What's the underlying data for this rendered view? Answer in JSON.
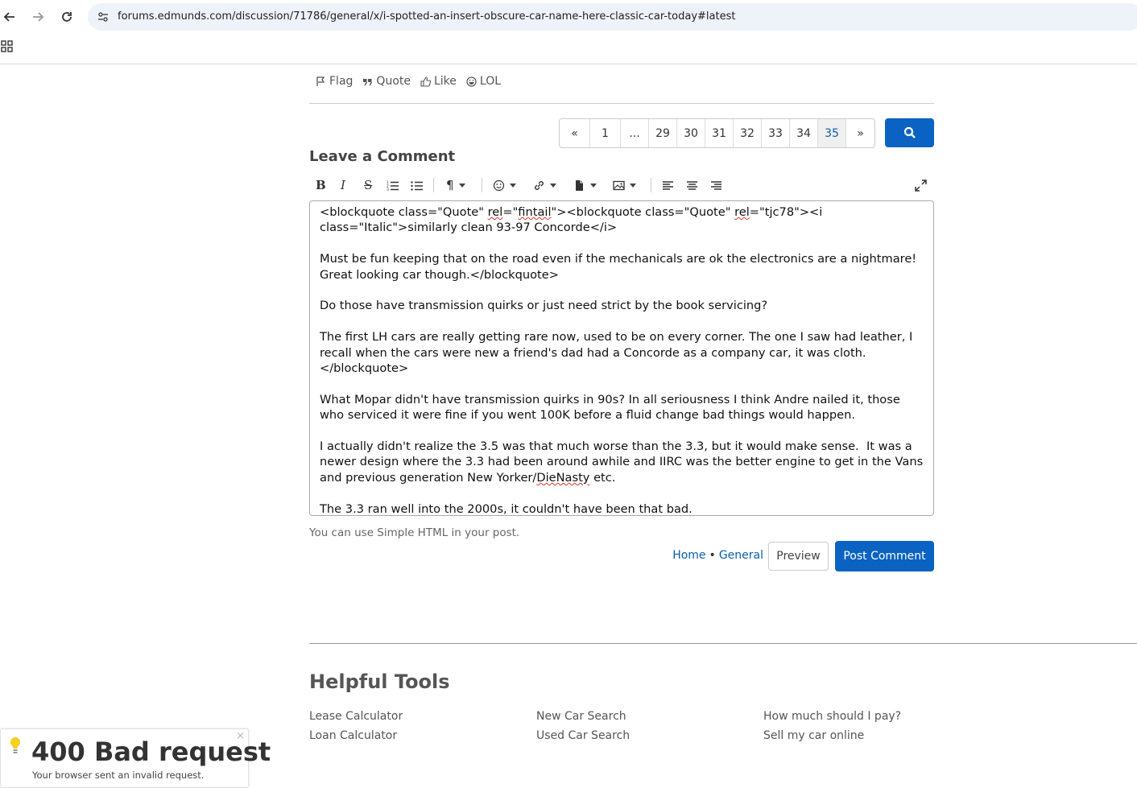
{
  "browser": {
    "url": "forums.edmunds.com/discussion/71786/general/x/i-spotted-an-insert-obscure-car-name-here-classic-car-today#latest",
    "icons": [
      "back-arrow-icon",
      "forward-arrow-icon",
      "reload-icon",
      "site-info-icon",
      "apps-grid-icon"
    ]
  },
  "post_actions": {
    "flag": "Flag",
    "quote": "Quote",
    "like": "Like",
    "lol": "LOL"
  },
  "pagination": {
    "prev": "«",
    "pages": [
      "1",
      "...",
      "29",
      "30",
      "31",
      "32",
      "33",
      "34",
      "35"
    ],
    "active": "35",
    "next": "»"
  },
  "comment": {
    "title": "Leave a Comment",
    "paragraphs": [
      "<blockquote class=\"Quote\" rel=\"fintail\"><blockquote class=\"Quote\" rel=\"tjc78\"><i class=\"Italic\">similarly clean 93-97 Concorde</i>",
      "Must be fun keeping that on the road even if the mechanicals are ok the electronics are a nightmare!  Great looking car though.</blockquote>",
      "Do those have transmission quirks or just need strict by the book servicing?",
      "The first LH cars are really getting rare now, used to be on every corner. The one I saw had leather, I recall when the cars were new a friend's dad had a Concorde as a company car, it was cloth.</blockquote>",
      "What Mopar didn't have transmission quirks in 90s?  In all seriousness I think Andre nailed it, those who serviced it were fine if you went 100K before a fluid change bad things would happen.",
      "I actually didn't realize the 3.5 was that much worse than the 3.3, but it would make sense.  It was a newer design where the 3.3 had been around awhile and IIRC was the better engine to get in the Vans and previous generation New Yorker/DieNasty etc.",
      "The 3.3 ran well into the 2000s, it couldn't have been that bad."
    ],
    "hint": "You can use Simple HTML in your post.",
    "breadcrumb_home": "Home",
    "breadcrumb_sep": "•",
    "breadcrumb_general": "General",
    "preview_label": "Preview",
    "post_label": "Post Comment"
  },
  "tools": {
    "title": "Helpful Tools",
    "col1": [
      "Lease Calculator",
      "Loan Calculator"
    ],
    "col2": [
      "New Car Search",
      "Used Car Search"
    ],
    "col3": [
      "How much should I pay?",
      "Sell my car online"
    ]
  },
  "toast": {
    "title": "400 Bad request",
    "subtitle": "Your browser sent an invalid request.",
    "close": "×"
  },
  "colors": {
    "accent": "#0a63c2",
    "link": "#0a5eaa"
  }
}
